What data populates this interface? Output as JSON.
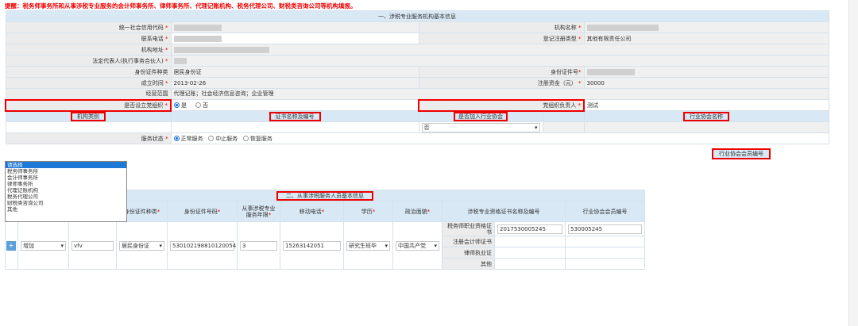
{
  "warning": "提醒：税务师事务所和从事涉税专业服务的会计师事务所、律师事务所、代理记账机构、税务代理公司、财税类咨询公司等机构填报。",
  "section1": {
    "title": "一、涉税专业服务机构基本信息",
    "credit_code_label": "统一社会信用代码",
    "org_name_label": "机构名称",
    "phone_label": "联系电话",
    "reg_type_label": "登记注册类型",
    "reg_type_value": "其他有限责任公司",
    "address_label": "机构地址",
    "legal_rep_label": "法定代表人(执行事务合伙人)",
    "id_type_label": "身份证件种类",
    "id_type_value": "居民身份证",
    "id_no_label": "身份证件号",
    "established_label": "成立时间",
    "established_value": "2013-02-26",
    "capital_label": "注册资金（元）",
    "capital_value": "30000",
    "scope_label": "经营范围",
    "scope_value": "代理记账；社会经济信息咨询；企业管理",
    "party_org_label": "是否设立党组织",
    "yes": "是",
    "no": "否",
    "party_leader_label": "党组织负责人",
    "party_leader_value": "测试",
    "org_type_header": "机构类别",
    "cert_header": "证书名称及编号",
    "join_assoc_header": "是否加入行业协会",
    "assoc_name_header": "行业协会名称",
    "assoc_member_header": "行业协会会员编号",
    "join_assoc_value": "否",
    "service_status_label": "服务状态",
    "status_normal": "正常服务",
    "status_suspend": "中止服务",
    "status_resume": "恢复服务"
  },
  "org_type_options": [
    "请选择",
    "税务师事务所",
    "会计师事务所",
    "律师事务所",
    "代理记账机构",
    "税务代理公司",
    "财税类咨询公司",
    "其他"
  ],
  "section2": {
    "title": "二、从事涉税服务人员基本信息",
    "headers": {
      "id_type": "身份证件种类",
      "id_no": "身份证件号码",
      "years": "从事涉税专业服务年限",
      "mobile": "移动电话",
      "education": "学历",
      "politics": "政治面貌",
      "qual": "涉税专业资格证书名称及编号",
      "member_no": "行业协会会员编号"
    },
    "row": {
      "plus": "+",
      "action": "增加",
      "name": "vfv",
      "id_type": "居民身份证",
      "id_no": "530102198810120054",
      "years": "3",
      "mobile": "15263142051",
      "education": "研究生班毕",
      "politics": "中国共产党"
    },
    "quals": [
      {
        "name": "税务师职业资格证书",
        "no": "2017530005245",
        "member": "530005245"
      },
      {
        "name": "注册会计师证书",
        "no": "",
        "member": ""
      },
      {
        "name": "律师执业证",
        "no": "",
        "member": ""
      },
      {
        "name": "其他",
        "no": "",
        "member": ""
      }
    ]
  }
}
